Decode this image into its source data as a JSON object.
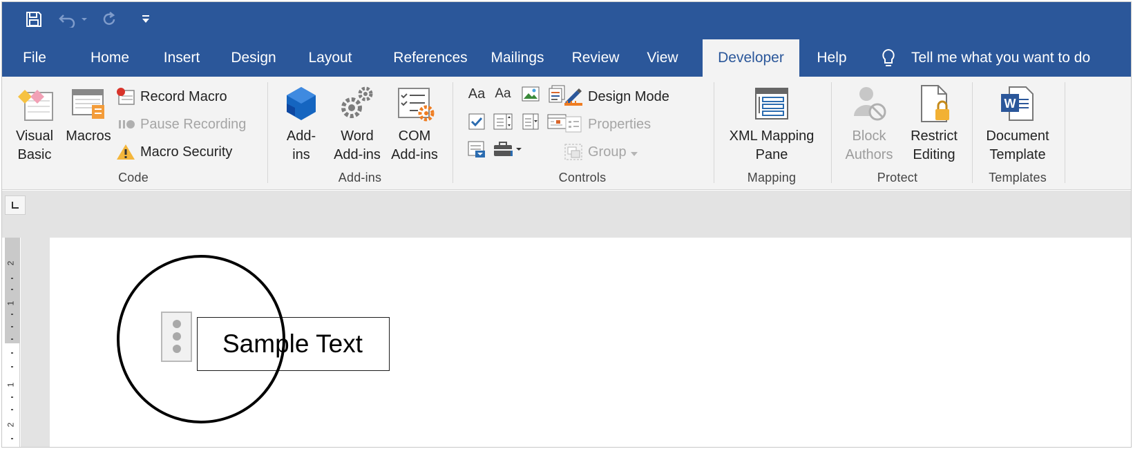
{
  "app": {
    "accent": "#2b579a",
    "ribbon_bg": "#f3f3f3"
  },
  "quick_access": {
    "save_icon": "save-icon",
    "undo_icon": "undo-icon",
    "redo_icon": "redo-icon",
    "customize_icon": "customize-qat-icon"
  },
  "tabs": [
    {
      "label": "File"
    },
    {
      "label": "Home"
    },
    {
      "label": "Insert"
    },
    {
      "label": "Design"
    },
    {
      "label": "Layout"
    },
    {
      "label": "References"
    },
    {
      "label": "Mailings"
    },
    {
      "label": "Review"
    },
    {
      "label": "View"
    },
    {
      "label": "Developer",
      "active": true
    },
    {
      "label": "Help"
    }
  ],
  "tell_me": {
    "label": "Tell me what you want to do",
    "icon": "lightbulb-icon"
  },
  "ribbon": {
    "code": {
      "label": "Code",
      "visual_basic": "Visual\nBasic",
      "macros": "Macros",
      "record_macro": "Record Macro",
      "pause_recording": "Pause Recording",
      "macro_security": "Macro Security"
    },
    "addins": {
      "label": "Add-ins",
      "addins": "Add-\nins",
      "word_addins": "Word\nAdd-ins",
      "com_addins": "COM\nAdd-ins"
    },
    "controls": {
      "label": "Controls",
      "rich_text": "Aa",
      "plain_text": "Aa",
      "design_mode": "Design Mode",
      "properties": "Properties",
      "group": "Group"
    },
    "mapping": {
      "label": "Mapping",
      "xml_mapping_pane": "XML Mapping\nPane"
    },
    "protect": {
      "label": "Protect",
      "block_authors": "Block\nAuthors",
      "restrict_editing": "Restrict\nEditing"
    },
    "templates": {
      "label": "Templates",
      "document_template": "Document\nTemplate"
    }
  },
  "ruler": {
    "labels": [
      "2",
      "1",
      "1",
      "2"
    ]
  },
  "document": {
    "content_control_text": "Sample Text"
  }
}
